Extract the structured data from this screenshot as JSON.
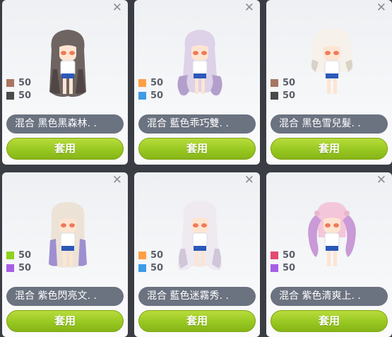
{
  "cards": [
    {
      "name": "混合  黑色黑森林. .",
      "apply_label": "套用",
      "close_glyph": "✕",
      "hair_icon": "long-wavy-hair-avatar",
      "hair_color": "#6e6462",
      "hair_shade": "#4f4645",
      "swatches": [
        {
          "color": "#a87660",
          "value": "50"
        },
        {
          "color": "#4a4a4a",
          "value": "50"
        }
      ]
    },
    {
      "name": "混合  藍色乖巧雙. .",
      "apply_label": "套用",
      "close_glyph": "✕",
      "hair_icon": "long-twin-curls-hair-avatar",
      "hair_color": "#ddd2e8",
      "hair_shade": "#b39fcb",
      "swatches": [
        {
          "color": "#ff9f45",
          "value": "50"
        },
        {
          "color": "#3e9be6",
          "value": "50"
        }
      ]
    },
    {
      "name": "混合  黑色雪兒髮. .",
      "apply_label": "套用",
      "close_glyph": "✕",
      "hair_icon": "fluffy-short-hair-avatar",
      "hair_color": "#f6f1ea",
      "hair_shade": "#d9d2c6",
      "swatches": [
        {
          "color": "#a87660",
          "value": "50"
        },
        {
          "color": "#4a4a4a",
          "value": "50"
        }
      ]
    },
    {
      "name": "混合  紫色閃亮文. .",
      "apply_label": "套用",
      "close_glyph": "✕",
      "hair_icon": "long-straight-hair-avatar",
      "hair_color": "#ece3d6",
      "hair_shade": "#9f8fcf",
      "swatches": [
        {
          "color": "#8fd21e",
          "value": "50"
        },
        {
          "color": "#a85ee6",
          "value": "50"
        }
      ]
    },
    {
      "name": "混合  藍色迷霧秀. .",
      "apply_label": "套用",
      "close_glyph": "✕",
      "hair_icon": "long-flowing-hair-avatar",
      "hair_color": "#eeeaf0",
      "hair_shade": "#cfc6d8",
      "swatches": [
        {
          "color": "#ff9f45",
          "value": "50"
        },
        {
          "color": "#3e9be6",
          "value": "50"
        }
      ]
    },
    {
      "name": "混合  紫色清爽上. .",
      "apply_label": "套用",
      "close_glyph": "✕",
      "hair_icon": "pink-twin-tails-hair-avatar",
      "hair_color": "#f4c6da",
      "hair_shade": "#c99ad6",
      "swatches": [
        {
          "color": "#e24b6e",
          "value": "50"
        },
        {
          "color": "#a85ee6",
          "value": "50"
        }
      ]
    }
  ]
}
